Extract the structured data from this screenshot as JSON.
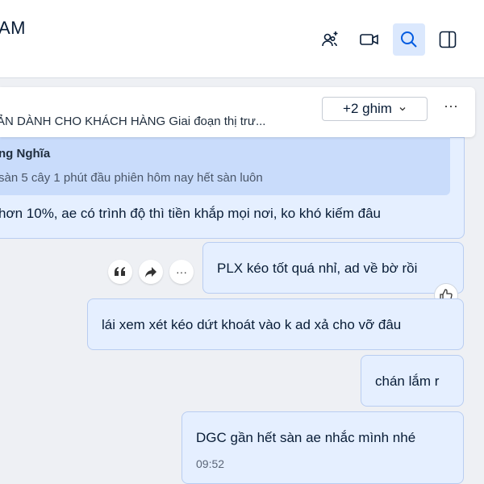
{
  "header": {
    "title": "AM",
    "buttons": [
      {
        "name": "add-member-icon"
      },
      {
        "name": "video-call-icon"
      },
      {
        "name": "search-icon"
      },
      {
        "name": "toggle-sidebar-icon"
      }
    ]
  },
  "pinned": {
    "text": "ẢN DÀNH CHO KHÁCH HÀNG Giai đoạn thị trư...",
    "pin_count_label": "+2 ghim",
    "more": "···"
  },
  "messages": {
    "top": {
      "quote_author": "ng Nghĩa",
      "quote_text": "sàn 5 cây 1 phút đầu phiên hôm nay hết sàn luôn",
      "text": "hơn 10%, ae có trình độ thì tiền khắp mọi nơi, ko khó kiếm đâu"
    },
    "m1": {
      "text": "PLX kéo tốt quá nhỉ, ad về bờ rồi"
    },
    "m2": {
      "text": "lái xem xét kéo dứt khoát vào k ad xả cho vỡ đâu"
    },
    "m3": {
      "text": "chán lắm r"
    },
    "m4": {
      "text": "DGC gần hết sàn ae nhắc mình nhé",
      "time": "09:52"
    }
  },
  "message_actions": {
    "more": "···"
  },
  "colors": {
    "bubble": "#e5efff",
    "quote": "#c9dcfb",
    "active_button": "#dbe8fd",
    "icon": "#081c36"
  }
}
